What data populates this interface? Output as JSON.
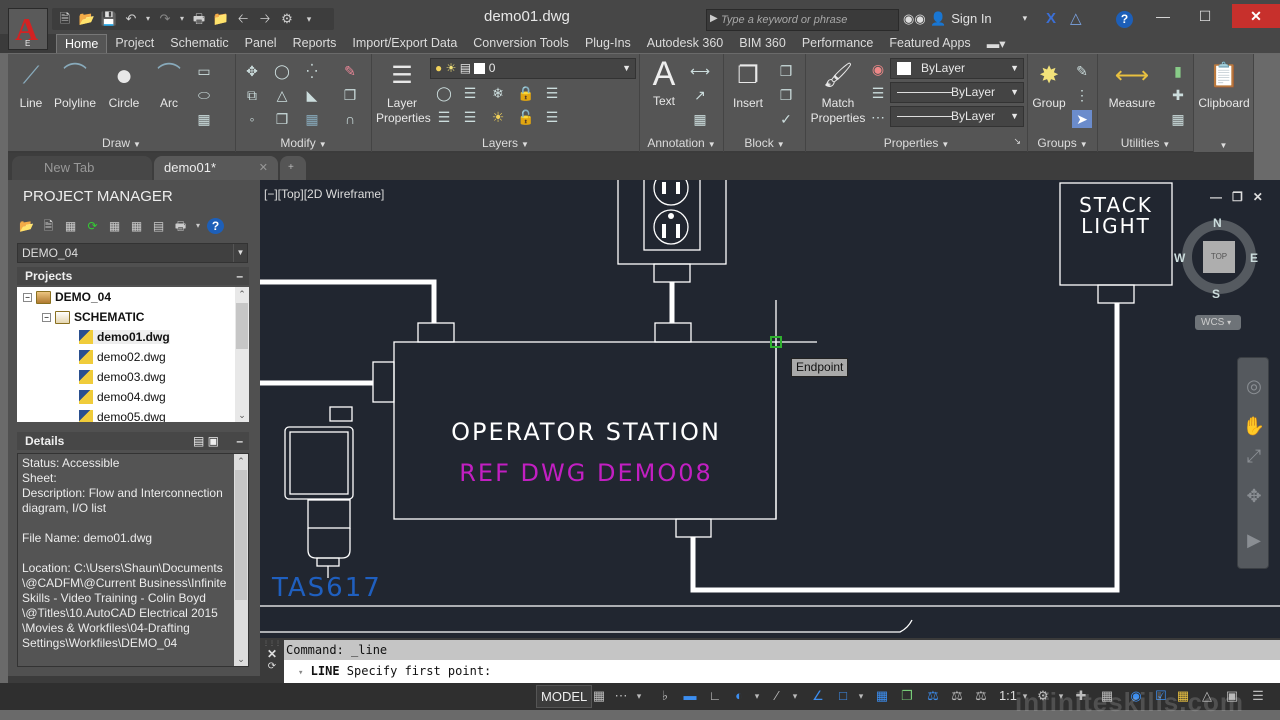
{
  "app": {
    "logo_letter": "A",
    "logo_sub": "E",
    "document_title": "demo01.dwg",
    "quick_access": [
      "new-icon",
      "open-icon",
      "save-icon",
      "undo-icon",
      "redo-icon",
      "plot-icon",
      "project-icon",
      "back-icon",
      "forward-icon",
      "workspace-icon",
      "customize-icon"
    ],
    "search_placeholder": "Type a keyword or phrase",
    "sign_in": "Sign In",
    "window_buttons": {
      "minimize": "—",
      "maximize": "☐",
      "close": "✕"
    }
  },
  "ribbon": {
    "tabs": [
      "Home",
      "Project",
      "Schematic",
      "Panel",
      "Reports",
      "Import/Export Data",
      "Conversion Tools",
      "Plug-Ins",
      "Autodesk 360",
      "BIM 360",
      "Performance",
      "Featured Apps"
    ],
    "active_tab": "Home",
    "panels": {
      "draw": {
        "title": "Draw",
        "buttons": [
          "Line",
          "Polyline",
          "Circle",
          "Arc"
        ]
      },
      "modify": {
        "title": "Modify"
      },
      "layers": {
        "title": "Layers",
        "layer_properties": "Layer Properties",
        "current_layer": "0"
      },
      "annotation": {
        "title": "Annotation",
        "text": "Text"
      },
      "block": {
        "title": "Block",
        "insert": "Insert"
      },
      "properties": {
        "title": "Properties",
        "match": "Match Properties",
        "color": "ByLayer",
        "linetype": "ByLayer",
        "lineweight": "ByLayer"
      },
      "groups": {
        "title": "Groups",
        "group": "Group"
      },
      "utilities": {
        "title": "Utilities",
        "measure": "Measure"
      },
      "clipboard": {
        "title": "Clipboard"
      }
    }
  },
  "doc_tabs": [
    {
      "label": "New Tab",
      "active": false
    },
    {
      "label": "demo01*",
      "active": true
    }
  ],
  "project_manager": {
    "title": "PROJECT MANAGER",
    "project_select": "DEMO_04",
    "projects_header": "Projects",
    "tree": [
      {
        "label": "DEMO_04",
        "type": "project",
        "level": 0
      },
      {
        "label": "SCHEMATIC",
        "type": "folder",
        "level": 1
      },
      {
        "label": "demo01.dwg",
        "type": "drawing",
        "level": 2,
        "selected": true
      },
      {
        "label": "demo02.dwg",
        "type": "drawing",
        "level": 2
      },
      {
        "label": "demo03.dwg",
        "type": "drawing",
        "level": 2
      },
      {
        "label": "demo04.dwg",
        "type": "drawing",
        "level": 2
      },
      {
        "label": "demo05.dwg",
        "type": "drawing",
        "level": 2
      }
    ],
    "details_header": "Details",
    "details_text": "Status: Accessible\nSheet:\nDescription: Flow and Interconnection diagram, I/O list\n\nFile Name: demo01.dwg\n\nLocation: C:\\Users\\Shaun\\Documents\n\\@CADFM\\@Current Business\\Infinite\nSkills - Video Training - Colin Boyd\n\\@Titles\\10.AutoCAD Electrical 2015\n\\Movies & Workfiles\\04-Drafting\nSettings\\Workfiles\\DEMO_04"
  },
  "viewport": {
    "label": "[−][Top][2D Wireframe]",
    "drawing_texts": {
      "operator_station": "OPERATOR  STATION",
      "ref_dwg": "REF  DWG  DEMO08",
      "stack_light_1": "STACK",
      "stack_light_2": "LIGHT",
      "tag": "TAS617"
    },
    "colors": {
      "background": "#212630",
      "ref_text": "#c21fc2",
      "tag_text": "#1f5fbf",
      "snap_marker": "#2fb02f"
    },
    "osnap_tooltip": "Endpoint",
    "viewcube": {
      "top": "TOP",
      "north": "N",
      "south": "S",
      "east": "E",
      "west": "W",
      "ucs": "WCS"
    }
  },
  "command_line": {
    "history": "Command: _line",
    "prompt_command": "LINE",
    "prompt_text": " Specify first point:"
  },
  "status_bar": {
    "model": "MODEL",
    "scale": "1:1"
  },
  "watermark": "infiniteskills.com"
}
